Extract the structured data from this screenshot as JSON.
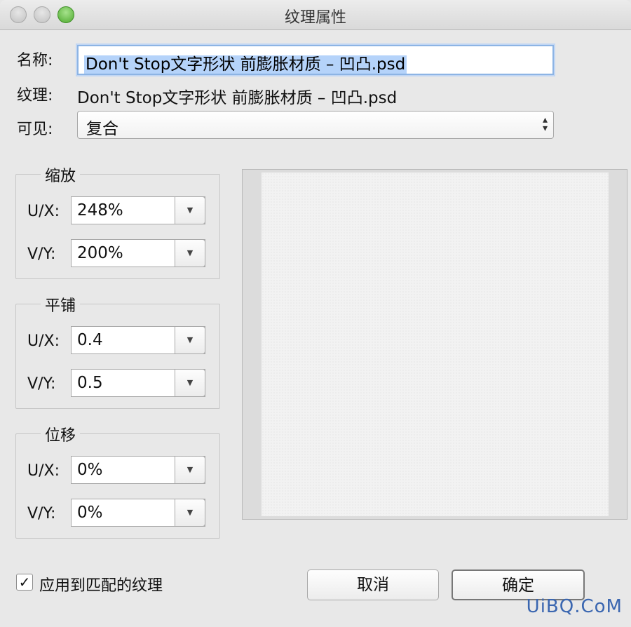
{
  "window": {
    "title": "纹理属性"
  },
  "form": {
    "name_label": "名称:",
    "name_value": "Don't Stop文字形状 前膨胀材质 – 凹凸.psd",
    "texture_label": "纹理:",
    "texture_value": "Don't Stop文字形状 前膨胀材质 – 凹凸.psd",
    "visible_label": "可见:",
    "visible_value": "复合"
  },
  "groups": [
    {
      "title": "缩放",
      "ux_label": "U/X:",
      "ux_value": "248%",
      "vy_label": "V/Y:",
      "vy_value": "200%"
    },
    {
      "title": "平铺",
      "ux_label": "U/X:",
      "ux_value": "0.4",
      "vy_label": "V/Y:",
      "vy_value": "0.5"
    },
    {
      "title": "位移",
      "ux_label": "U/X:",
      "ux_value": "0%",
      "vy_label": "V/Y:",
      "vy_value": "0%"
    }
  ],
  "footer": {
    "apply_checked": true,
    "apply_label": "应用到匹配的纹理",
    "cancel_label": "取消",
    "ok_label": "确定"
  },
  "watermark": "UiBQ.CoM"
}
